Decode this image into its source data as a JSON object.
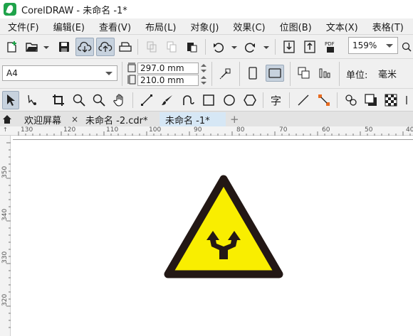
{
  "window": {
    "title": "CorelDRAW - 未命名 -1*"
  },
  "menu": [
    "文件(F)",
    "编辑(E)",
    "查看(V)",
    "布局(L)",
    "对象(J)",
    "效果(C)",
    "位图(B)",
    "文本(X)",
    "表格(T)"
  ],
  "toolbar": {
    "zoom_value": "159%"
  },
  "property_bar": {
    "page_size": "A4",
    "width_value": "297.0 mm",
    "height_value": "210.0 mm",
    "units_label": "单位:",
    "units_value": "毫米"
  },
  "tabs": [
    {
      "label": "欢迎屏幕",
      "close": "×",
      "active": false
    },
    {
      "label": "未命名 -2.cdr*",
      "active": false
    },
    {
      "label": "未命名 -1*",
      "active": true
    },
    {
      "label": "+",
      "active": false
    }
  ],
  "ruler": {
    "horizontal_ticks": [
      "130",
      "120",
      "110",
      "100",
      "90",
      "80",
      "70",
      "60",
      "50",
      "40"
    ],
    "vertical_ticks": [
      "350",
      "340",
      "330",
      "320"
    ]
  },
  "canvas": {
    "sign": {
      "fill_color": "#f9ee00",
      "border_color": "#231815",
      "symbol_color": "#231815"
    }
  },
  "colors": {
    "menubar_bg": "#f0f0f0",
    "tab_active_bg": "#d6e7f5",
    "tool_active_bg": "#c7d2de"
  }
}
